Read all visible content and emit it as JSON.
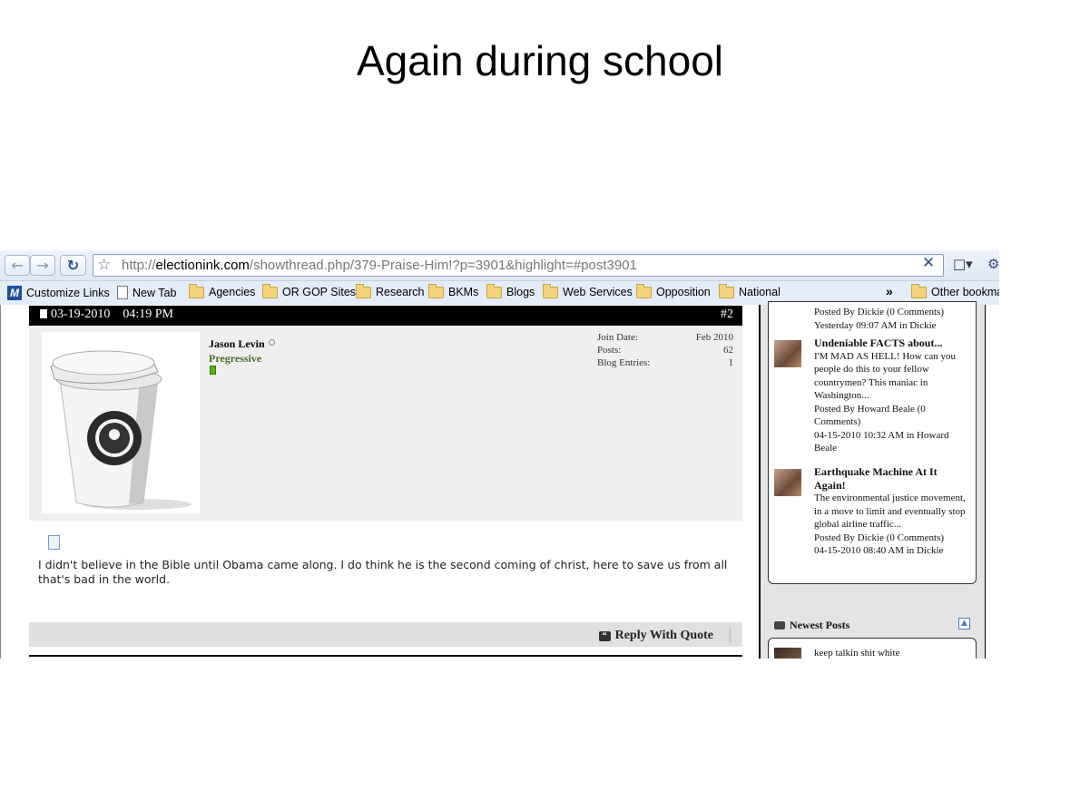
{
  "slide": {
    "title": "Again during school"
  },
  "browser": {
    "url_prefix": "http://",
    "url_host": "electionink.com",
    "url_path": "/showthread.php/379-Praise-Him!?p=3901&highlight=#post3901",
    "bookmarks": [
      "Customize Links",
      "New Tab",
      "Agencies",
      "OR GOP Sites",
      "Research",
      "BKMs",
      "Blogs",
      "Web Services",
      "Opposition",
      "National"
    ],
    "overflow_label": "»",
    "other_bookmarks": "Other bookma"
  },
  "post": {
    "date": "03-19-2010",
    "time": "04:19 PM",
    "number": "#2",
    "username": "Jason Levin",
    "user_title": "Pregressive",
    "stats": [
      {
        "label": "Join Date:",
        "value": "Feb 2010"
      },
      {
        "label": "Posts:",
        "value": "62"
      },
      {
        "label": "Blog Entries:",
        "value": "1"
      }
    ],
    "message": "I didn't believe in the Bible until Obama came along. I do think he is the second coming of christ, here to save us from all that's bad in the world.",
    "reply_label": "Reply With Quote"
  },
  "sidebar": {
    "entry0": {
      "meta1": "Posted By Dickie (0 Comments)",
      "meta2": "Yesterday 09:07 AM in Dickie"
    },
    "entry1": {
      "title": "Undeniable FACTS about...",
      "body": "I'M MAD AS HELL! How can you people do this to your fellow countrymen? This maniac in Washington...",
      "meta1": "Posted By Howard Beale (0 Comments)",
      "meta2": "04-15-2010 10:32 AM in Howard Beale"
    },
    "entry2": {
      "title": "Earthquake Machine At It Again!",
      "body": "The environmental justice movement, in a move to limit and eventually stop global airline traffic...",
      "meta1": "Posted By Dickie (0 Comments)",
      "meta2": "04-15-2010 08:40 AM in Dickie"
    },
    "newest_posts_heading": "Newest Posts",
    "newest_post_preview": "keep talkin shit white"
  }
}
